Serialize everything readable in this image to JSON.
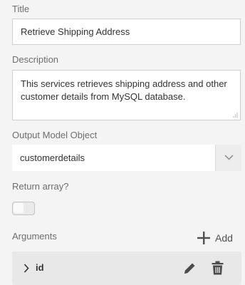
{
  "title_section": {
    "label": "Title",
    "value": "Retrieve Shipping Address"
  },
  "description_section": {
    "label": "Description",
    "value": "This services retrieves shipping address and other customer details from MySQL database."
  },
  "output_model_section": {
    "label": "Output Model Object",
    "selected_value": "customerdetails",
    "dropdown_icon": "chevron-down-icon"
  },
  "return_array_section": {
    "label": "Return array?",
    "toggle_on": false
  },
  "arguments_section": {
    "label": "Arguments",
    "add_label": "Add",
    "add_icon": "plus-icon",
    "items": [
      {
        "name": "id",
        "expand_icon": "chevron-right-icon",
        "edit_icon": "pencil-icon",
        "delete_icon": "trash-icon"
      }
    ]
  }
}
